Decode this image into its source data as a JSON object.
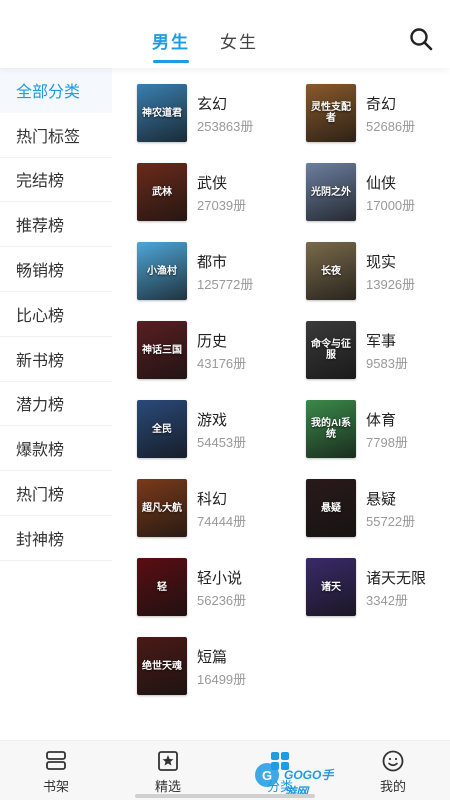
{
  "header": {
    "tabs": [
      {
        "label": "男生",
        "active": true
      },
      {
        "label": "女生",
        "active": false
      }
    ],
    "search_icon": "search-icon"
  },
  "sidebar": {
    "items": [
      {
        "label": "全部分类",
        "active": true
      },
      {
        "label": "热门标签"
      },
      {
        "label": "完结榜"
      },
      {
        "label": "推荐榜"
      },
      {
        "label": "畅销榜"
      },
      {
        "label": "比心榜"
      },
      {
        "label": "新书榜"
      },
      {
        "label": "潜力榜"
      },
      {
        "label": "爆款榜"
      },
      {
        "label": "热门榜"
      },
      {
        "label": "封神榜"
      }
    ]
  },
  "categories": [
    {
      "name": "玄幻",
      "count": "253863册",
      "cover_text": "神农道君",
      "cover_color": "#3a7fb0"
    },
    {
      "name": "奇幻",
      "count": "52686册",
      "cover_text": "灵性支配者",
      "cover_color": "#8a5a2a"
    },
    {
      "name": "武侠",
      "count": "27039册",
      "cover_text": "武林",
      "cover_color": "#6b2a1a"
    },
    {
      "name": "仙侠",
      "count": "17000册",
      "cover_text": "光阴之外",
      "cover_color": "#6c7fa0"
    },
    {
      "name": "都市",
      "count": "125772册",
      "cover_text": "小渔村",
      "cover_color": "#4fa6d8"
    },
    {
      "name": "现实",
      "count": "13926册",
      "cover_text": "长夜",
      "cover_color": "#7a6a4a"
    },
    {
      "name": "历史",
      "count": "43176册",
      "cover_text": "神话三国",
      "cover_color": "#5a1e22"
    },
    {
      "name": "军事",
      "count": "9583册",
      "cover_text": "命令与征服",
      "cover_color": "#3a3a3a"
    },
    {
      "name": "游戏",
      "count": "54453册",
      "cover_text": "全民",
      "cover_color": "#2a4a7a"
    },
    {
      "name": "体育",
      "count": "7798册",
      "cover_text": "我的AI系统",
      "cover_color": "#3a8a4a"
    },
    {
      "name": "科幻",
      "count": "74444册",
      "cover_text": "超凡大航",
      "cover_color": "#7a3a1a"
    },
    {
      "name": "悬疑",
      "count": "55722册",
      "cover_text": "悬疑",
      "cover_color": "#2a1a1a"
    },
    {
      "name": "轻小说",
      "count": "56236册",
      "cover_text": "轻",
      "cover_color": "#5a0e12"
    },
    {
      "name": "诸天无限",
      "count": "3342册",
      "cover_text": "诸天",
      "cover_color": "#3a2a6a"
    },
    {
      "name": "短篇",
      "count": "16499册",
      "cover_text": "绝世天魂",
      "cover_color": "#4a1a16"
    }
  ],
  "bottom_nav": {
    "items": [
      {
        "label": "书架",
        "icon": "bookshelf-icon"
      },
      {
        "label": "精选",
        "icon": "featured-star-icon"
      },
      {
        "label": "分类",
        "icon": "category-icon"
      },
      {
        "label": "我的",
        "icon": "smile-profile-icon"
      }
    ]
  },
  "watermark": {
    "text": "GOGO手游网"
  },
  "colors": {
    "accent": "#1e9be2",
    "text": "#222222",
    "muted": "#999999"
  }
}
